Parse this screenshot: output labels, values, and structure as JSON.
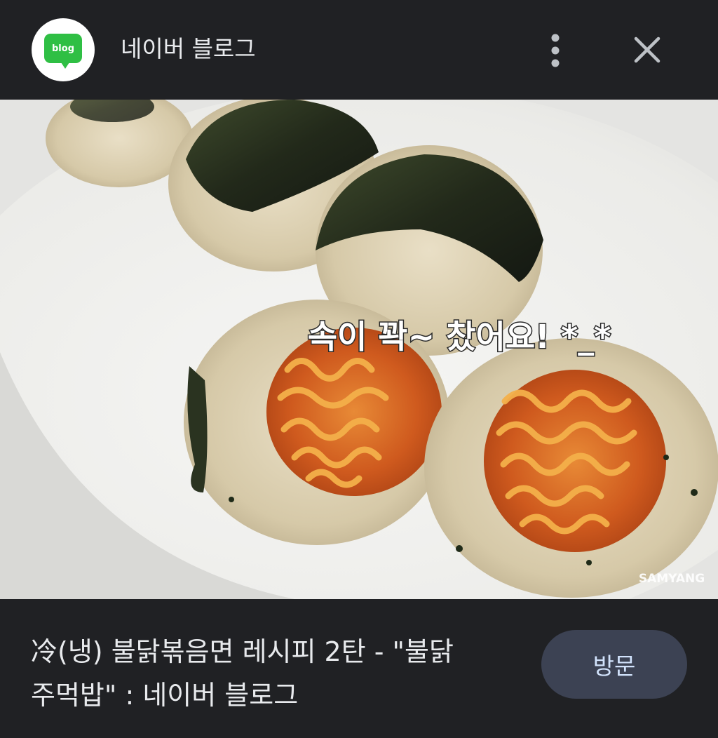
{
  "header": {
    "favicon_text": "blog",
    "site_name": "네이버 블로그",
    "more_icon": "more-vert-icon",
    "close_icon": "close-icon"
  },
  "image": {
    "overlay_caption": "속이 꽉~ 찼어요! *_*",
    "watermark": "SAMYANG",
    "lens_icon": "lens-icon"
  },
  "footer": {
    "title": "冷(냉) 불닭볶음면 레시피 2탄 - \"불닭 주먹밥\" : 네이버 블로그",
    "visit_label": "방문"
  },
  "colors": {
    "background": "#202124",
    "favicon_green": "#2fbf44",
    "visit_button_bg": "#3c4253",
    "visit_button_text": "#d2e3fc"
  }
}
